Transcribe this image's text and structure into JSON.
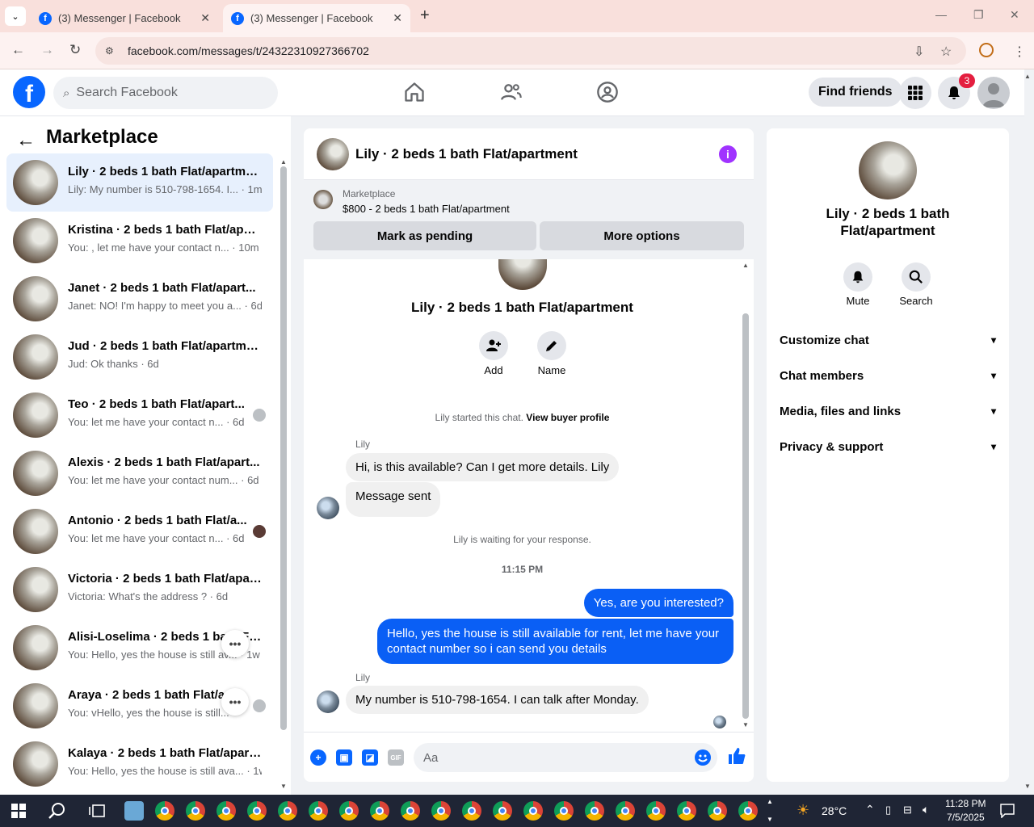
{
  "browser": {
    "tabs": [
      {
        "title": "(3) Messenger | Facebook",
        "active": false
      },
      {
        "title": "(3) Messenger | Facebook",
        "active": true
      }
    ],
    "url": "facebook.com/messages/t/24322310927366702"
  },
  "fb_header": {
    "logo": "f",
    "search_placeholder": "Search Facebook",
    "find_friends_label": "Find friends",
    "notification_count": "3"
  },
  "sidebar": {
    "title": "Marketplace",
    "conversations": [
      {
        "title": "Lily · 2 beds 1 bath Flat/apartment",
        "preview": "Lily: My number is 510-798-1654. I... · 1m",
        "selected": true
      },
      {
        "title": "Kristina · 2 beds 1 bath Flat/apar...",
        "preview": "You: , let me have your contact n... · 10m"
      },
      {
        "title": "Janet · 2 beds 1 bath Flat/apart...",
        "preview": "Janet: NO! I'm happy to meet you a... · 6d"
      },
      {
        "title": "Jud · 2 beds 1 bath Flat/apartment",
        "preview": "Jud: Ok thanks · 6d"
      },
      {
        "title": "Teo · 2 beds 1 bath Flat/apart...",
        "preview": "You: let me have your contact n... · 6d"
      },
      {
        "title": "Alexis · 2 beds 1 bath Flat/apart...",
        "preview": "You: let me have your contact num... · 6d"
      },
      {
        "title": "Antonio · 2 beds 1 bath Flat/a...",
        "preview": "You: let me have your contact n... · 6d"
      },
      {
        "title": "Victoria · 2 beds 1 bath Flat/apar...",
        "preview": "Victoria: What's the address ? · 6d"
      },
      {
        "title": "Alisi-Loselima · 2 beds 1 bath Fl...",
        "preview": "You: Hello, yes the house is still av... · 1w"
      },
      {
        "title": "Araya · 2 beds 1 bath Flat/ap...",
        "preview": "You: vHello, yes the house is still..."
      },
      {
        "title": "Kalaya · 2 beds 1 bath Flat/apart...",
        "preview": "You: Hello, yes the house is still ava... · 1w"
      }
    ],
    "more_dots": "•••"
  },
  "chat": {
    "title": "Lily · 2 beds 1 bath Flat/apartment",
    "info_icon": "i",
    "marketplace_label": "Marketplace",
    "listing": "$800 - 2 beds 1 bath Flat/apartment",
    "mark_pending_label": "Mark as pending",
    "more_options_label": "More options",
    "profile_name": "Lily · 2 beds 1 bath Flat/apartment",
    "add_label": "Add",
    "name_label": "Name",
    "started_text": "Lily started this chat.",
    "view_profile_link": "View buyer profile",
    "sender_1": "Lily",
    "msg_1": "Hi, is this available? Can I get more details. Lily",
    "msg_2": "Message sent",
    "waiting_text": "Lily is waiting for your response.",
    "timestamp": "11:15 PM",
    "msg_3": "Yes, are you interested?",
    "msg_4": "Hello, yes the house is still available for rent, let me have your contact number so i can send you details",
    "sender_2": "Lily",
    "msg_5": "My number is 510-798-1654. I can talk after Monday.",
    "compose_placeholder": "Aa",
    "gif_label": "GIF"
  },
  "right_panel": {
    "name": "Lily · 2 beds 1 bath Flat/apartment",
    "mute_label": "Mute",
    "search_label": "Search",
    "sections": [
      "Customize chat",
      "Chat members",
      "Media, files and links",
      "Privacy & support"
    ]
  },
  "taskbar": {
    "temperature": "28°C",
    "time": "11:28 PM",
    "date": "7/5/2025"
  },
  "colors": {
    "brand": "#0866ff",
    "outgoing_bubble": "#0a5ff5",
    "selected_row": "#e7f0fd",
    "info_purple": "#a033ff",
    "badge_red": "#e41e3f"
  }
}
